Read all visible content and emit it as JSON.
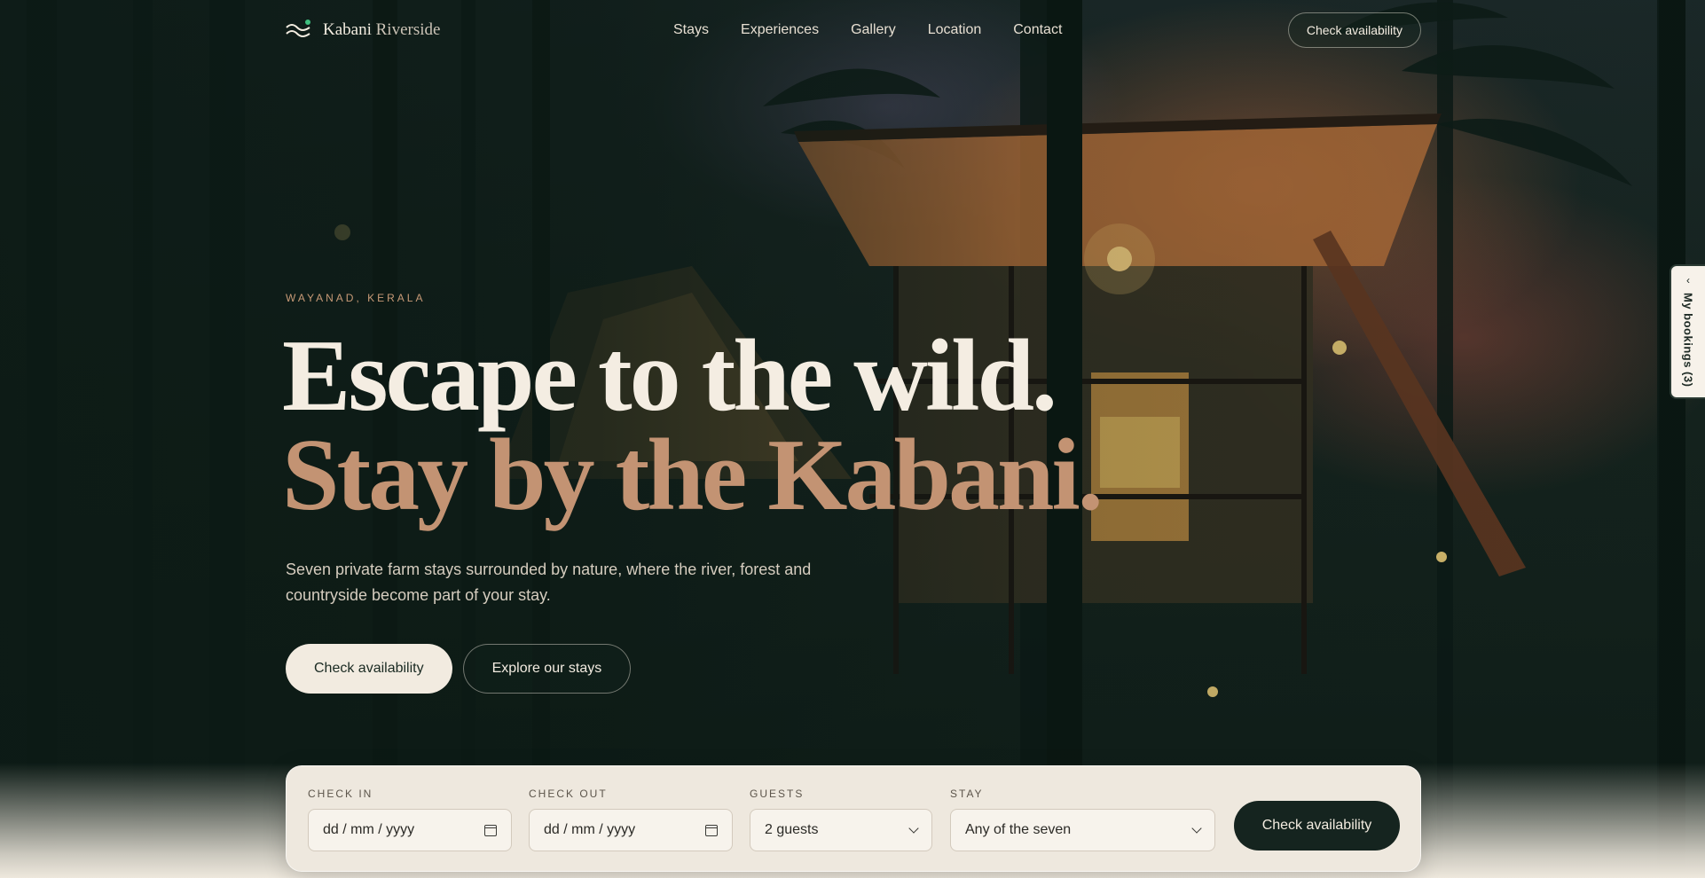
{
  "brand": {
    "name_main": "Kabani",
    "name_accent": "Riverside",
    "icon": "waves-icon"
  },
  "nav": {
    "links": [
      "Stays",
      "Experiences",
      "Gallery",
      "Location",
      "Contact"
    ],
    "cta_label": "Check availability"
  },
  "hero": {
    "eyebrow": "WAYANAD, KERALA",
    "headline_line1": "Escape to the wild.",
    "headline_line2": "Stay by the Kabani.",
    "lede": "Seven private farm stays surrounded by nature, where the river, forest and countryside become part of your stay.",
    "primary_button": "Check availability",
    "secondary_button": "Explore our stays"
  },
  "side_tab": {
    "label": "My bookings (3)",
    "icon": "chevron-left-icon"
  },
  "booking": {
    "check_in": {
      "label": "CHECK IN",
      "placeholder": "dd / mm / yyyy",
      "icon": "calendar-icon"
    },
    "check_out": {
      "label": "CHECK OUT",
      "placeholder": "dd / mm / yyyy",
      "icon": "calendar-icon"
    },
    "guests": {
      "label": "GUESTS",
      "value": "2 guests",
      "icon": "chevron-down-icon"
    },
    "stay": {
      "label": "STAY",
      "value": "Any of the seven",
      "icon": "chevron-down-icon"
    },
    "submit_label": "Check availability"
  },
  "colors": {
    "accent": "#c39373",
    "dark": "#15241f",
    "cream": "#f2ebe0",
    "brand_dot": "#3fbf7f"
  }
}
